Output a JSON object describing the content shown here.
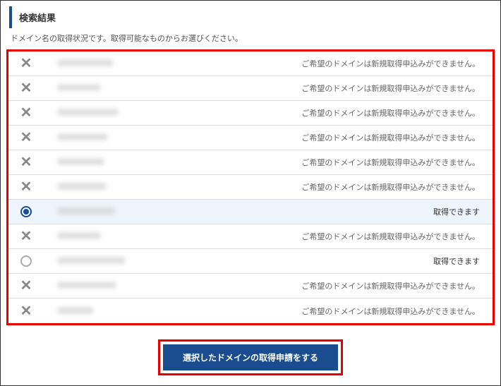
{
  "header": {
    "title": "検索結果"
  },
  "subheader": {
    "text": "ドメイン名の取得状況です。取得可能なものからお選びください。"
  },
  "statuses": {
    "unavailable": "ご希望のドメインは新規取得申込みができません。",
    "available": "取得できます"
  },
  "domains": [
    {
      "available": false,
      "selected": false,
      "blur_width": 78
    },
    {
      "available": false,
      "selected": false,
      "blur_width": 60
    },
    {
      "available": false,
      "selected": false,
      "blur_width": 85
    },
    {
      "available": false,
      "selected": false,
      "blur_width": 70
    },
    {
      "available": false,
      "selected": false,
      "blur_width": 65
    },
    {
      "available": false,
      "selected": false,
      "blur_width": 68
    },
    {
      "available": true,
      "selected": true,
      "blur_width": 80
    },
    {
      "available": false,
      "selected": false,
      "blur_width": 60
    },
    {
      "available": true,
      "selected": false,
      "blur_width": 95
    },
    {
      "available": false,
      "selected": false,
      "blur_width": 82
    },
    {
      "available": false,
      "selected": false,
      "blur_width": 50
    }
  ],
  "button": {
    "submit_label": "選択したドメインの取得申請をする"
  }
}
